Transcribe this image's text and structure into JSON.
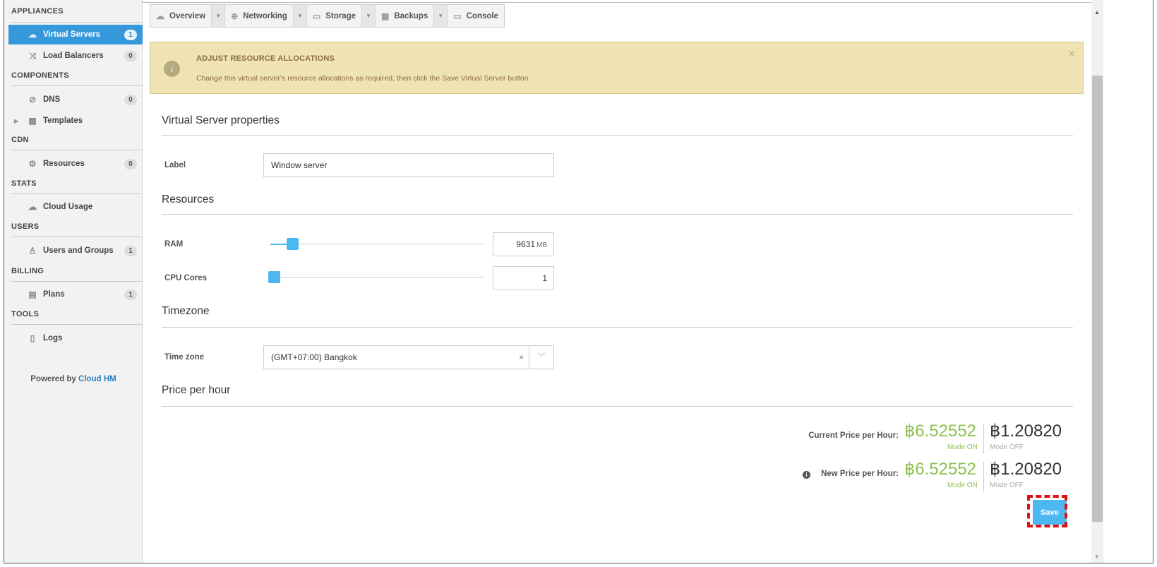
{
  "sidebar": {
    "sections": {
      "appliances": "APPLIANCES",
      "components": "COMPONENTS",
      "cdn": "CDN",
      "stats": "STATS",
      "users": "USERS",
      "billing": "BILLING",
      "tools": "TOOLS"
    },
    "items": {
      "virtual_servers": {
        "label": "Virtual Servers",
        "count": "1",
        "icon": "cloud-icon"
      },
      "load_balancers": {
        "label": "Load Balancers",
        "count": "0",
        "icon": "shuffle-icon"
      },
      "dns": {
        "label": "DNS",
        "count": "0",
        "icon": "compass-icon"
      },
      "templates": {
        "label": "Templates",
        "icon": "grid-icon"
      },
      "resources": {
        "label": "Resources",
        "count": "0",
        "icon": "globe-gear-icon"
      },
      "cloud_usage": {
        "label": "Cloud Usage",
        "icon": "cloud-usage-icon"
      },
      "users_groups": {
        "label": "Users and Groups",
        "count": "1",
        "icon": "users-icon"
      },
      "plans": {
        "label": "Plans",
        "count": "1",
        "icon": "document-icon"
      },
      "logs": {
        "label": "Logs",
        "icon": "file-icon"
      }
    },
    "powered_by": "Powered by",
    "powered_brand": "Cloud HM"
  },
  "tabs": {
    "overview": "Overview",
    "networking": "Networking",
    "storage": "Storage",
    "backups": "Backups",
    "console": "Console"
  },
  "alert": {
    "title": "ADJUST RESOURCE ALLOCATIONS",
    "text": "Change this virtual server's resource allocations as required, then click the Save Virtual Server button."
  },
  "form": {
    "properties_heading": "Virtual Server properties",
    "label_label": "Label",
    "label_value": "Window server",
    "resources_heading": "Resources",
    "ram_label": "RAM",
    "ram_value": "9631",
    "ram_unit": "MB",
    "ram_slider_fraction": 0.09,
    "cpu_label": "CPU Cores",
    "cpu_value": "1",
    "cpu_slider_fraction": 0.0,
    "timezone_heading": "Timezone",
    "timezone_label": "Time zone",
    "timezone_value": "(GMT+07:00) Bangkok",
    "clear_symbol": "×",
    "price_heading": "Price per hour"
  },
  "price": {
    "current_label": "Current Price per Hour:",
    "new_label": "New Price per Hour:",
    "current_on": "฿6.52552",
    "current_off": "฿1.20820",
    "new_on": "฿6.52552",
    "new_off": "฿1.20820",
    "mode_on": "Mode ON",
    "mode_off": "Mode OFF"
  },
  "save_label": "Save",
  "colors": {
    "accent": "#3498db",
    "slider": "#4db8f0",
    "price_on": "#8cc152",
    "alert_bg": "#f0e3b3",
    "highlight": "#e01010"
  }
}
